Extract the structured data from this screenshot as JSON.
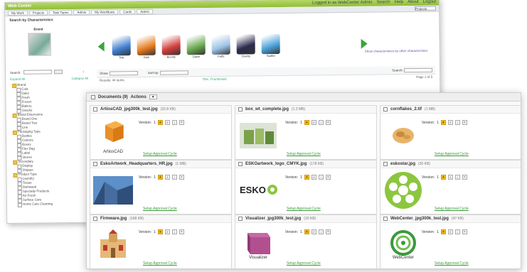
{
  "app": {
    "title": "Web Center",
    "user_links": [
      "Logged in as WebCenter Admin",
      "Search",
      "Help",
      "About",
      "Logout"
    ]
  },
  "menu": {
    "tabs": [
      "My Work",
      "Projects",
      "Task Types",
      "Admin",
      "My Workflows",
      "Cards",
      "Admin"
    ],
    "search_select": "Projects"
  },
  "search_section": {
    "title": "Search by Characteristics",
    "brand_label": "Brand",
    "browse_link": "Show characteristics by other characteristics"
  },
  "products": [
    {
      "name": "Tide",
      "color": "#3f7fd0"
    },
    {
      "name": "Gain",
      "color": "#e57a1e"
    },
    {
      "name": "Bounty",
      "color": "#d23d3d"
    },
    {
      "name": "Dawn",
      "color": "#6aa84f"
    },
    {
      "name": "Puffs",
      "color": "#9cc2e5"
    },
    {
      "name": "Downy",
      "color": "#2b2b4e"
    },
    {
      "name": "Swiffer",
      "color": "#4aa0d8"
    }
  ],
  "left_panel": {
    "search_label": "Search:",
    "search_button": "Go",
    "expand_all": "Expand All",
    "collapse_all": "Collapse All",
    "tree": [
      {
        "label": "Brand",
        "level": 1,
        "folder": true
      },
      {
        "label": "Cola",
        "level": 2
      },
      {
        "label": "Dairy",
        "level": 2
      },
      {
        "label": "Fresh",
        "level": 2
      },
      {
        "label": "Frozen",
        "level": 2
      },
      {
        "label": "Bakery",
        "level": 2
      },
      {
        "label": "Snacks",
        "level": 2
      },
      {
        "label": "Brand Extensions",
        "level": 1,
        "folder": true
      },
      {
        "label": "Brand One",
        "level": 2
      },
      {
        "label": "Brand Two",
        "level": 2
      },
      {
        "label": "Line",
        "level": 2
      },
      {
        "label": "Packaging Type",
        "level": 1,
        "folder": true
      },
      {
        "label": "Bottles",
        "level": 2
      },
      {
        "label": "Cartons",
        "level": 2
      },
      {
        "label": "Boxes",
        "level": 2
      },
      {
        "label": "Flex Bag",
        "level": 2
      },
      {
        "label": "Label",
        "level": 2
      },
      {
        "label": "Sleeve",
        "level": 2
      },
      {
        "label": "Secondary",
        "level": 1,
        "folder": true
      },
      {
        "label": "Display",
        "level": 2
      },
      {
        "label": "Shipper",
        "level": 2
      },
      {
        "label": "Product Type",
        "level": 1,
        "folder": true
      },
      {
        "label": "Laundry",
        "level": 2
      },
      {
        "label": "Tissue",
        "level": 2
      },
      {
        "label": "Dishwash",
        "level": 2
      },
      {
        "label": "Specialty Products",
        "level": 2
      },
      {
        "label": "Air Fresh",
        "level": 2
      },
      {
        "label": "Surface Care",
        "level": 2
      },
      {
        "label": "Home Care Cleaning",
        "level": 2
      }
    ]
  },
  "filterbar": {
    "show_label": "Show:",
    "show_value": "Projects",
    "sort_label": "Sort by:",
    "sort_value": "Name",
    "search_label": "Search:"
  },
  "resultsbar": {
    "found": "Results: 44 items",
    "columns": "Title, Thumbnails",
    "paging": "Page 1 of 5"
  },
  "documents": {
    "header_label": "Documents (9)",
    "actions_label": "Actions",
    "actions_button": "▼",
    "version_label": "Version:",
    "approval_link": "Setup Approval Cycle",
    "items": [
      {
        "name": "ArtiosCAD_jpg300k_test.jpg",
        "size": "(32.8 KB)",
        "version": "1",
        "thumb": "artioscad",
        "thumb_caption": "ArtiosCAD"
      },
      {
        "name": "box_wt_complete.jpg",
        "size": "(1.2 MB)",
        "version": "1",
        "thumb": "box",
        "thumb_caption": ""
      },
      {
        "name": "cornflakes_2.tif",
        "size": "(1 MB)",
        "version": "1",
        "thumb": "cornflakes",
        "thumb_caption": ""
      },
      {
        "name": "EskoArtwork_Headquarters_HR.jpg",
        "size": "(1 MB)",
        "version": "1",
        "thumb": "building",
        "thumb_caption": ""
      },
      {
        "name": "ESKOartwork_logo_CMYK.jpg",
        "size": "(178 KB)",
        "version": "1",
        "thumb": "esko",
        "thumb_caption": "ESKO"
      },
      {
        "name": "eskostar.jpg",
        "size": "(30 KB)",
        "version": "1",
        "thumb": "eskostar",
        "thumb_caption": ""
      },
      {
        "name": "Firmware.jpg",
        "size": "(188 KB)",
        "version": "1",
        "thumb": "firmware",
        "thumb_caption": ""
      },
      {
        "name": "Visualizer_jpg300k_test.jpg",
        "size": "(30 KB)",
        "version": "1",
        "thumb": "visualizer",
        "thumb_caption": "Visualizer"
      },
      {
        "name": "WebCenter_jpg300k_test.jpg",
        "size": "(47 KB)",
        "version": "1",
        "thumb": "webcenter",
        "thumb_caption": "WebCenter"
      }
    ]
  }
}
